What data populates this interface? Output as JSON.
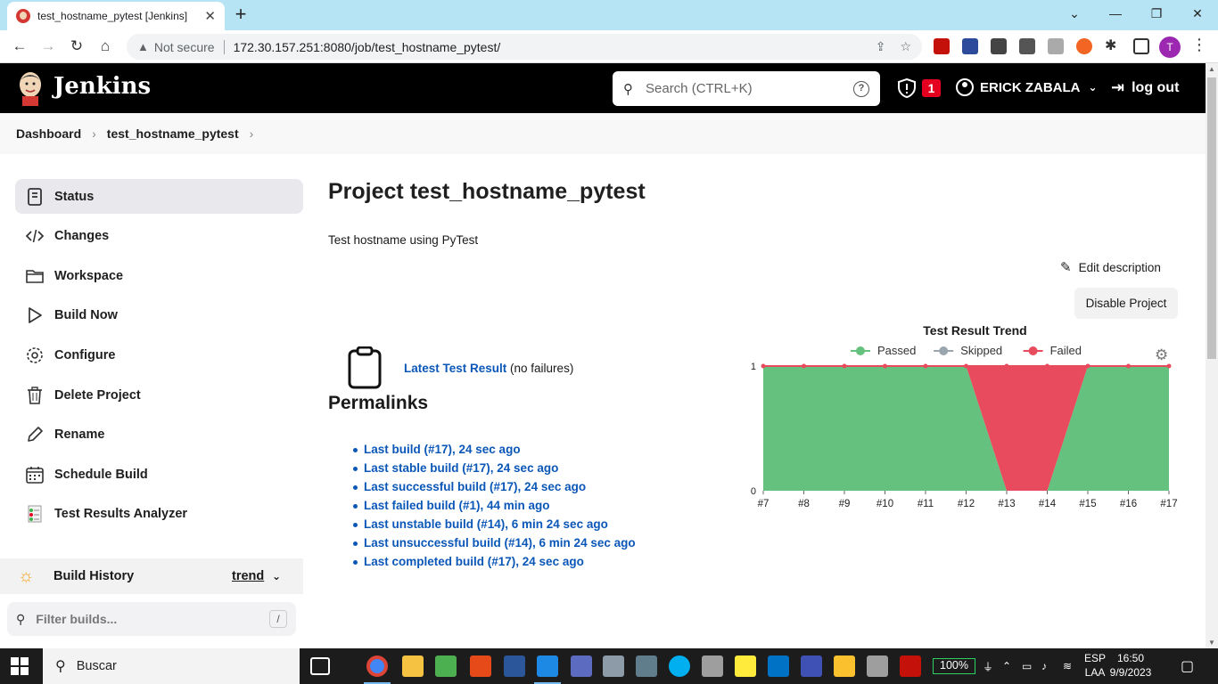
{
  "browser": {
    "tab_title": "test_hostname_pytest [Jenkins]",
    "tab_close": "✕",
    "new_tab": "+",
    "security_label": "Not secure",
    "url": "172.30.157.251:8080/job/test_hostname_pytest/",
    "profile_initial": "T",
    "window_controls": [
      "⌄",
      "—",
      "❐",
      "✕"
    ]
  },
  "header": {
    "brand": "Jenkins",
    "search_placeholder": "Search (CTRL+K)",
    "help": "?",
    "security_count": "1",
    "user_name": "ERICK ZABALA",
    "logout_label": "log out"
  },
  "breadcrumb": {
    "items": [
      "Dashboard",
      "test_hostname_pytest"
    ]
  },
  "sidebar": {
    "items": [
      {
        "label": "Status",
        "icon": "status-icon"
      },
      {
        "label": "Changes",
        "icon": "code-icon"
      },
      {
        "label": "Workspace",
        "icon": "folder-icon"
      },
      {
        "label": "Build Now",
        "icon": "play-icon"
      },
      {
        "label": "Configure",
        "icon": "gear-icon"
      },
      {
        "label": "Delete Project",
        "icon": "trash-icon"
      },
      {
        "label": "Rename",
        "icon": "pencil-icon"
      },
      {
        "label": "Schedule Build",
        "icon": "calendar-icon"
      },
      {
        "label": "Test Results Analyzer",
        "icon": "report-icon"
      }
    ],
    "build_history": {
      "title": "Build History",
      "trend_label": "trend",
      "filter_placeholder": "Filter builds...",
      "shortcut": "/"
    }
  },
  "main": {
    "title": "Project test_hostname_pytest",
    "description": "Test hostname using PyTest",
    "edit_description": "Edit description",
    "disable_button": "Disable Project",
    "latest_test_link": "Latest Test Result",
    "latest_test_note": " (no failures)",
    "permalinks_heading": "Permalinks",
    "permalinks": [
      "Last build (#17), 24 sec ago",
      "Last stable build (#17), 24 sec ago",
      "Last successful build (#17), 24 sec ago",
      "Last failed build (#1), 44 min ago",
      "Last unstable build (#14), 6 min 24 sec ago",
      "Last unsuccessful build (#14), 6 min 24 sec ago",
      "Last completed build (#17), 24 sec ago"
    ]
  },
  "chart_data": {
    "type": "area",
    "title": "Test Result Trend",
    "categories": [
      "#7",
      "#8",
      "#9",
      "#10",
      "#11",
      "#12",
      "#13",
      "#14",
      "#15",
      "#16",
      "#17"
    ],
    "series": [
      {
        "name": "Passed",
        "color": "#64c17e",
        "values": [
          1,
          1,
          1,
          1,
          1,
          1,
          0,
          0,
          1,
          1,
          1
        ]
      },
      {
        "name": "Skipped",
        "color": "#9aa5ad",
        "values": [
          0,
          0,
          0,
          0,
          0,
          0,
          0,
          0,
          0,
          0,
          0
        ]
      },
      {
        "name": "Failed",
        "color": "#e84b5d",
        "values": [
          0,
          0,
          0,
          0,
          0,
          0,
          1,
          1,
          0,
          0,
          0
        ]
      }
    ],
    "yticks": [
      "0",
      "1"
    ],
    "ylim": [
      0,
      1
    ],
    "legend_position": "top",
    "stacked": true
  },
  "taskbar": {
    "search_placeholder": "Buscar",
    "battery": "100%",
    "language": [
      "ESP",
      "LAA"
    ],
    "time": "16:50",
    "date": "9/9/2023"
  }
}
